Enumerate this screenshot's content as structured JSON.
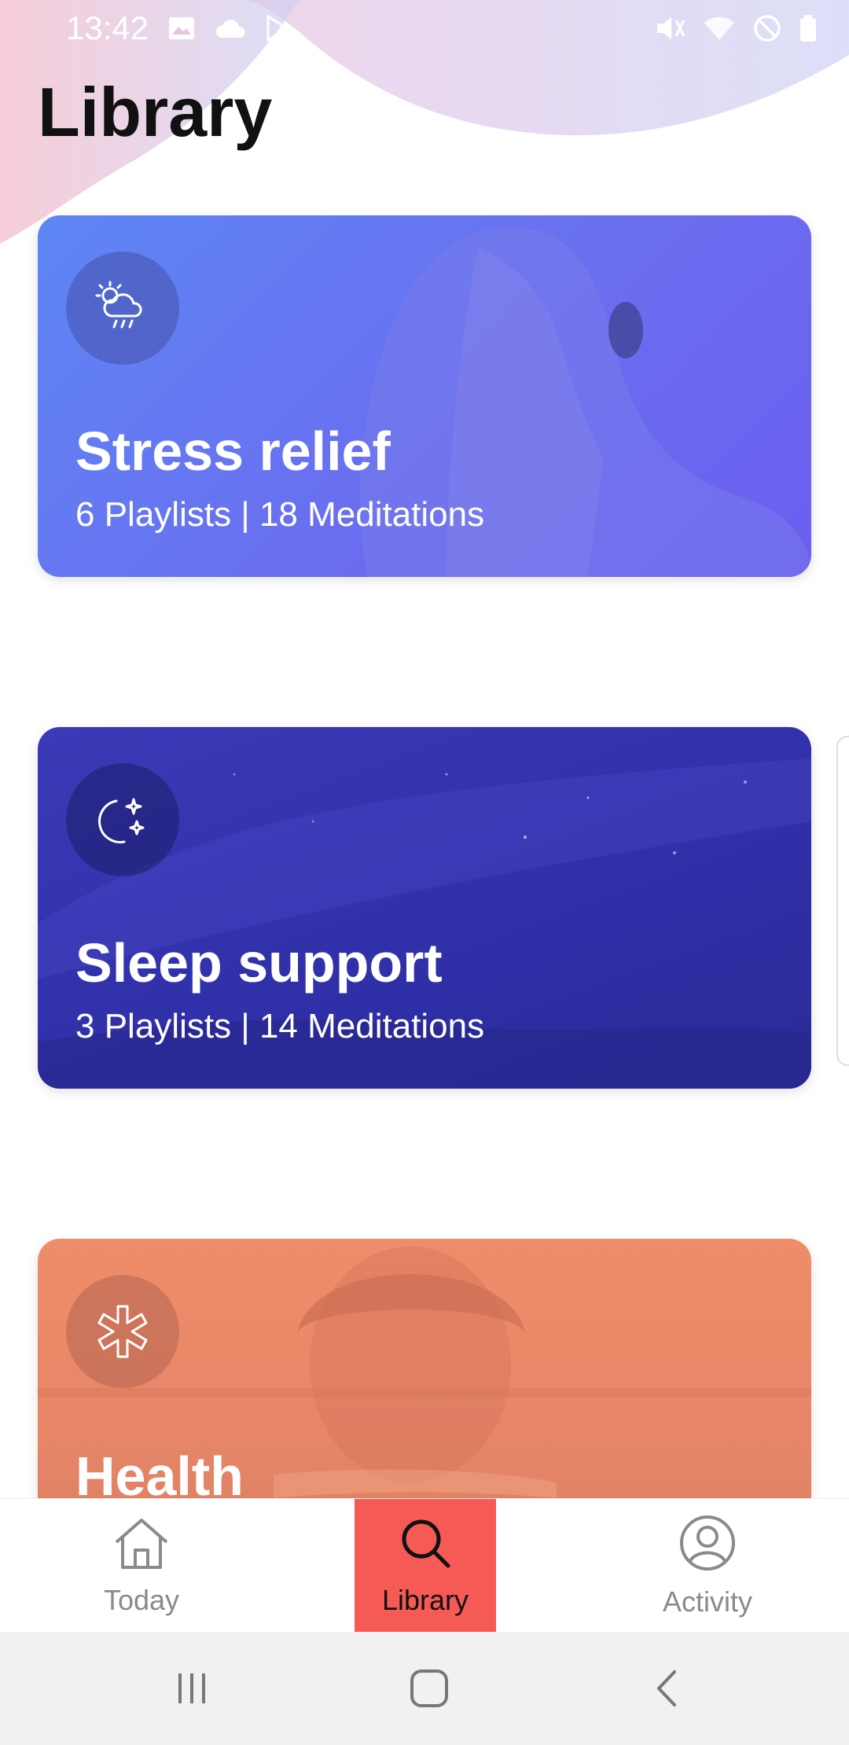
{
  "status_bar": {
    "time": "13:42",
    "left_icons": [
      "gallery-icon",
      "cloud-icon",
      "play-store-icon"
    ],
    "right_icons": [
      "mute-icon",
      "wifi-icon",
      "do-not-disturb-icon",
      "battery-icon"
    ]
  },
  "header": {
    "title": "Library"
  },
  "cards": [
    {
      "title": "Stress relief",
      "subtitle": "6 Playlists | 18 Meditations",
      "icon": "weather-storm-icon",
      "color": "#6a6ef0"
    },
    {
      "title": "Sleep support",
      "subtitle": "3 Playlists | 14 Meditations",
      "icon": "moon-stars-icon",
      "color": "#3333aa"
    },
    {
      "title": "Health",
      "subtitle": "",
      "icon": "medical-asterisk-icon",
      "color": "#e58567"
    }
  ],
  "bottom_nav": {
    "items": [
      {
        "label": "Today",
        "icon": "home-icon",
        "active": false
      },
      {
        "label": "Library",
        "icon": "search-icon",
        "active": true
      },
      {
        "label": "Activity",
        "icon": "user-circle-icon",
        "active": false
      }
    ],
    "active_color": "#f55a55"
  },
  "system_nav": [
    "recents-button",
    "home-button",
    "back-button"
  ]
}
